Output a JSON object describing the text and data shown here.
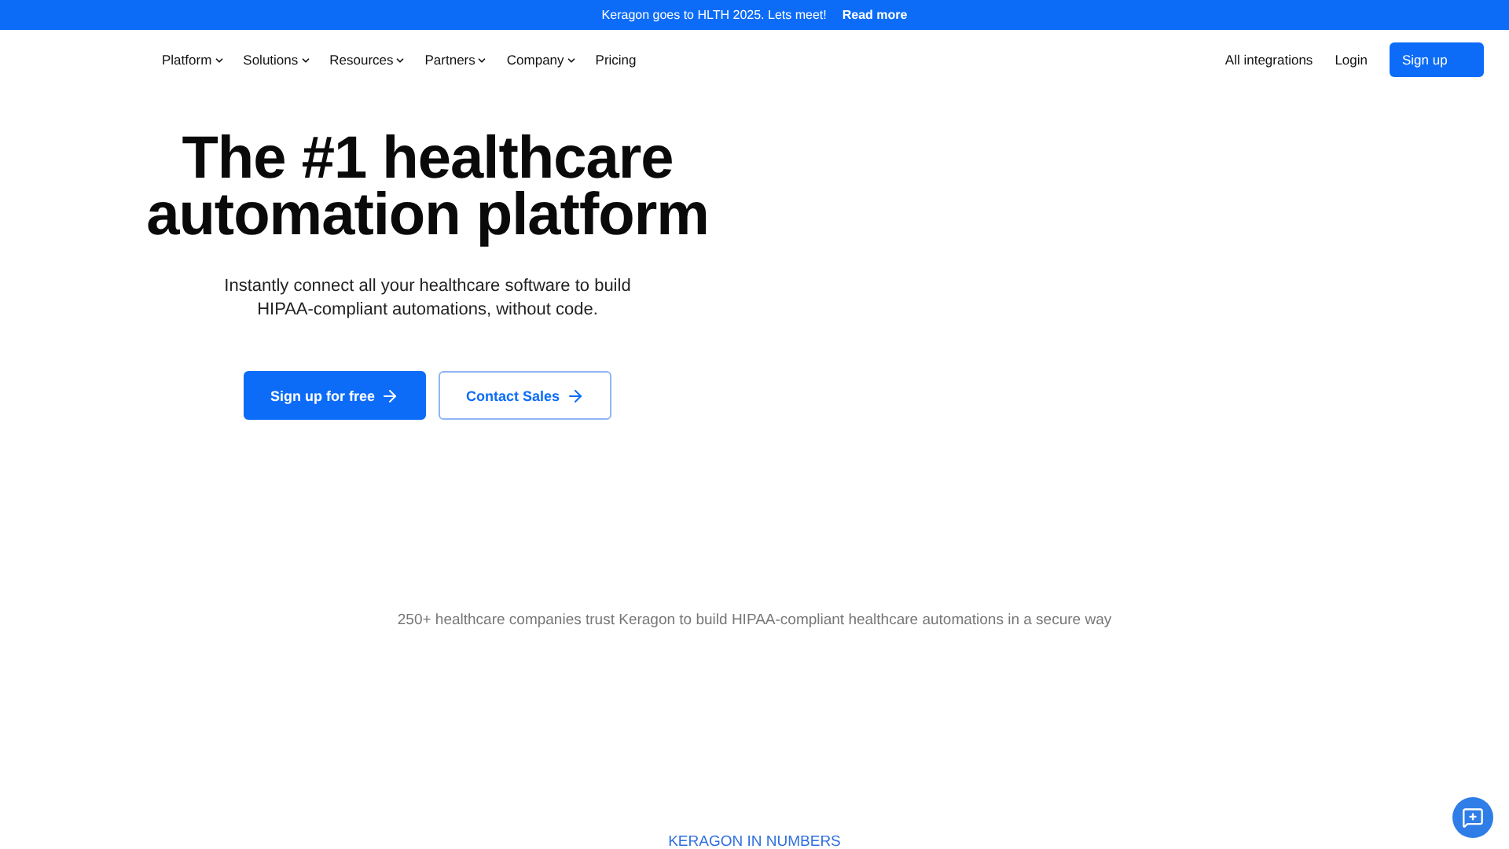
{
  "announcement": {
    "text": "Keragon goes to HLTH 2025. Lets meet!",
    "link": "Read more"
  },
  "nav": {
    "items": [
      {
        "label": "Platform",
        "kind": "dropdown"
      },
      {
        "label": "Solutions",
        "kind": "dropdown"
      },
      {
        "label": "Resources",
        "kind": "dropdown"
      },
      {
        "label": "Partners",
        "kind": "dropdown"
      },
      {
        "label": "Company",
        "kind": "dropdown"
      },
      {
        "label": "Pricing",
        "kind": "link"
      }
    ],
    "right_links": [
      "All integrations",
      "Login"
    ],
    "cta": "Sign up"
  },
  "hero": {
    "title_lines": [
      "The #1 healthcare",
      "automation platform"
    ],
    "subtitle_lines": [
      "Instantly connect all your healthcare software to build",
      "HIPAA-compliant automations, without code."
    ],
    "buttons": [
      {
        "label": "Sign up for free",
        "kind": "primary"
      },
      {
        "label": "Contact Sales",
        "kind": "outline"
      }
    ]
  },
  "trust_text": "250+ healthcare companies trust Keragon to build HIPAA-compliant healthcare automations in a secure way",
  "section_label": "KERAGON IN NUMBERS"
}
